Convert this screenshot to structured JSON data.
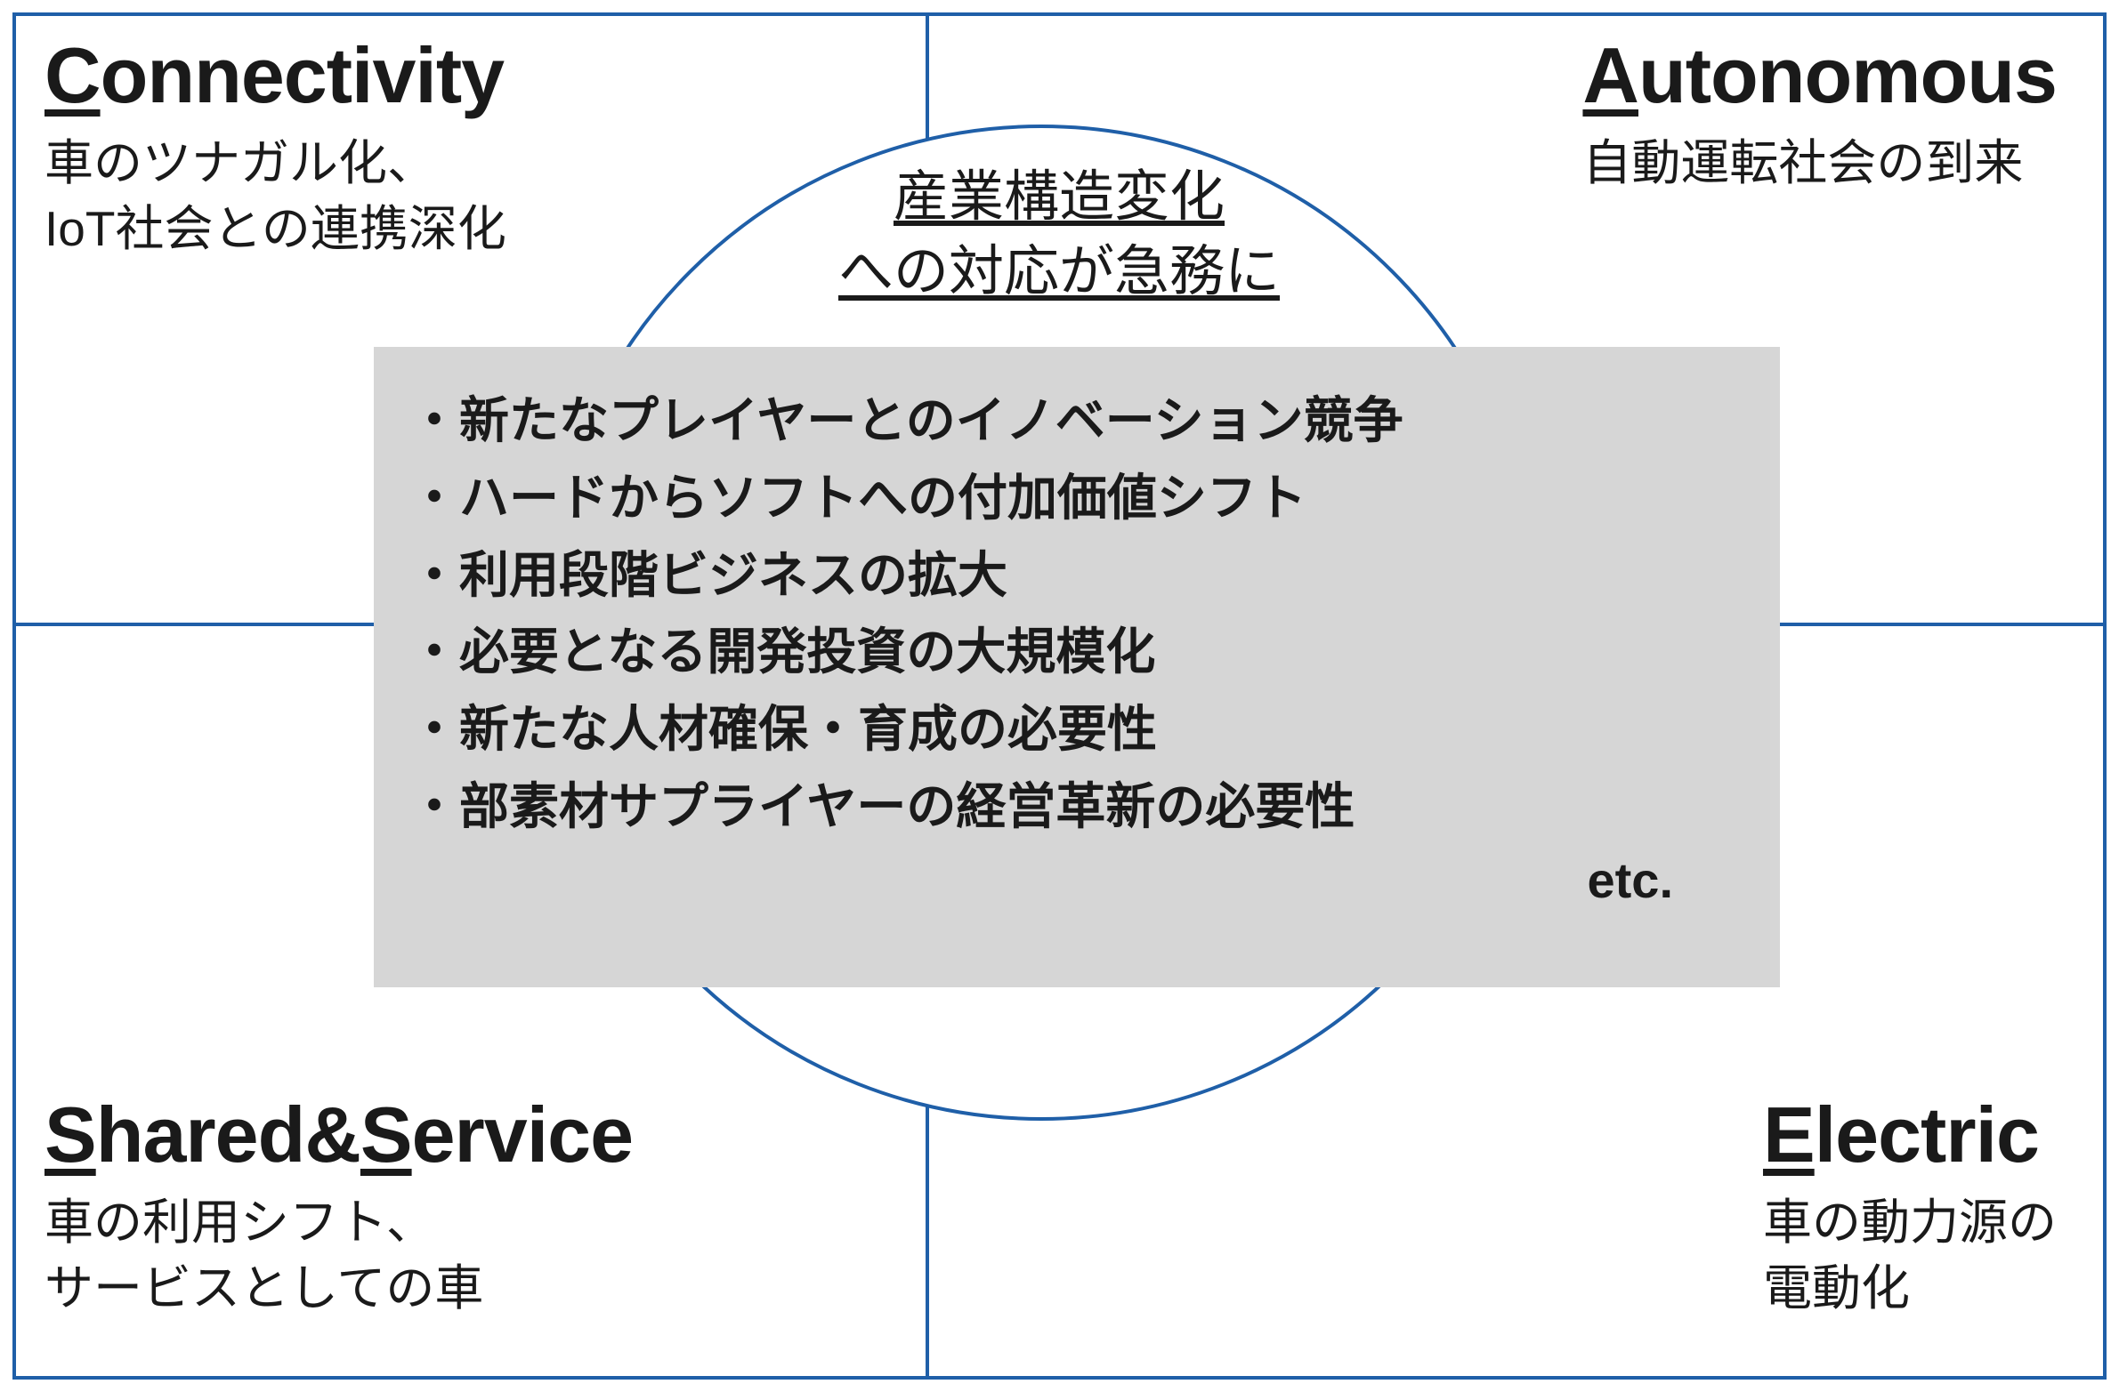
{
  "quadrants": {
    "top_left": {
      "title_pre": "C",
      "title_rest": "onnectivity",
      "desc_l1": "車のツナガル化、",
      "desc_l2": "IoT社会との連携深化"
    },
    "top_right": {
      "title_pre": "A",
      "title_rest": "utonomous",
      "desc_l1": "自動運転社会の到来",
      "desc_l2": ""
    },
    "bottom_left": {
      "title_pre": "S",
      "title_mid": "hared&",
      "title_pre2": "S",
      "title_rest": "ervice",
      "desc_l1": "車の利用シフト、",
      "desc_l2": "サービスとしての車"
    },
    "bottom_right": {
      "title_pre": "E",
      "title_rest": "lectric",
      "desc_l1": "車の動力源の",
      "desc_l2": "電動化"
    }
  },
  "center_heading": {
    "l1": "産業構造変化",
    "l2": "への対応が急務に"
  },
  "center_box": {
    "items": [
      "新たなプレイヤーとのイノベーション競争",
      "ハードからソフトへの付加価値シフト",
      "利用段階ビジネスの拡大",
      "必要となる開発投資の大規模化",
      "新たな人材確保・育成の必要性",
      "部素材サプライヤーの経営革新の必要性"
    ],
    "etc": "etc."
  }
}
